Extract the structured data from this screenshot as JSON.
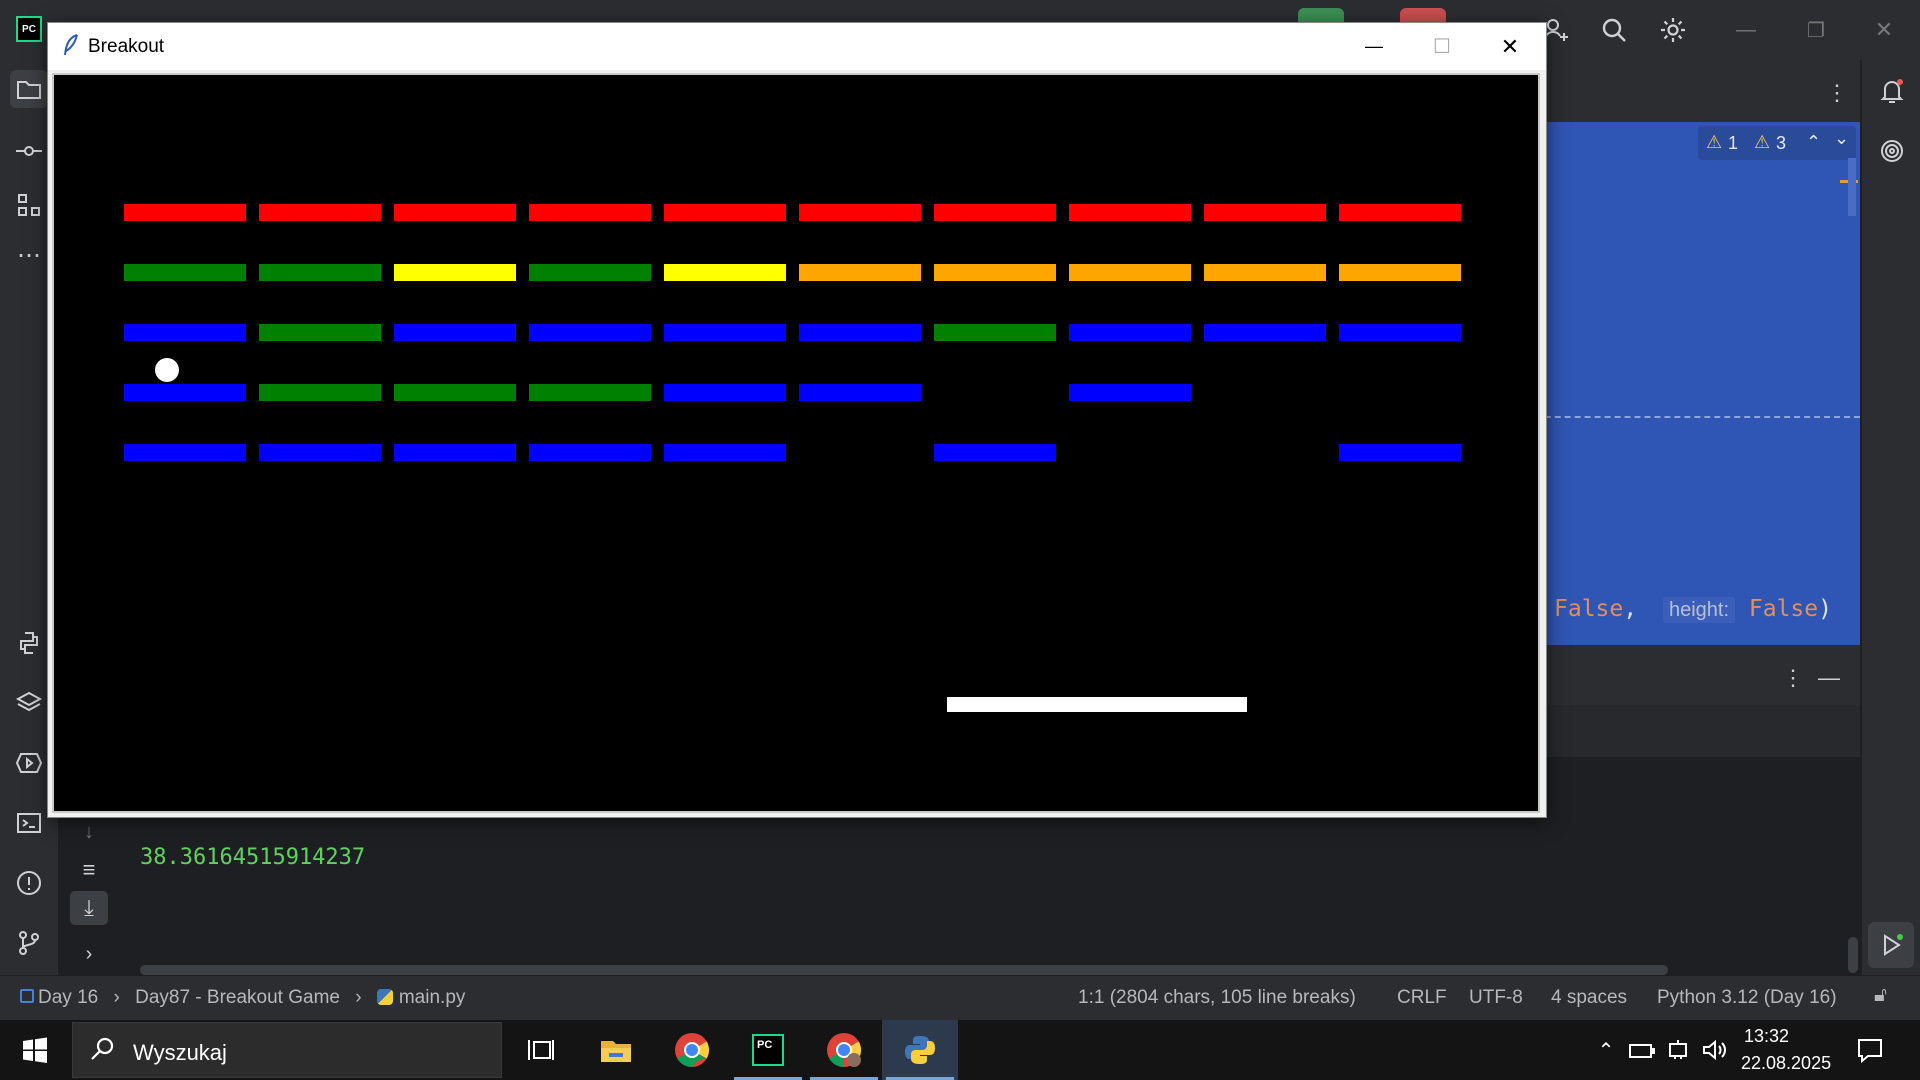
{
  "window": {
    "title": "Breakout",
    "minimize_glyph": "—",
    "maximize_glyph": "☐",
    "close_glyph": "✕"
  },
  "game": {
    "colors": {
      "red": "#ff0000",
      "green": "#008000",
      "yellow": "#ffff00",
      "orange": "#ffa500",
      "blue": "#0000ff",
      "white": "#ffffff",
      "black": "#000000"
    },
    "brick_rows": [
      [
        "red",
        "red",
        "red",
        "red",
        "red",
        "red",
        "red",
        "red",
        "red",
        "red"
      ],
      [
        "green",
        "green",
        "yellow",
        "green",
        "yellow",
        "orange",
        "orange",
        "orange",
        "orange",
        "orange"
      ],
      [
        "blue",
        "green",
        "blue",
        "blue",
        "blue",
        "blue",
        "green",
        "blue",
        "blue",
        "blue"
      ],
      [
        "blue",
        "green",
        "green",
        "green",
        "blue",
        "blue",
        null,
        "blue",
        null,
        null
      ],
      [
        "blue",
        "blue",
        "blue",
        "blue",
        "blue",
        null,
        "blue",
        null,
        null,
        "blue"
      ]
    ]
  },
  "editor": {
    "warnings": {
      "errors": "1",
      "warnings": "3"
    },
    "code_fragment": {
      "value1": "False",
      "comma": ",",
      "hint_label": "height:",
      "value2": "False",
      "paren": ")"
    }
  },
  "console": {
    "output": "38.36164515914237"
  },
  "statusbar": {
    "breadcrumb": [
      "Day 16",
      "Day87 - Breakout Game",
      "main.py"
    ],
    "position": "1:1 (2804 chars, 105 line breaks)",
    "line_ending": "CRLF",
    "encoding": "UTF-8",
    "indent": "4 spaces",
    "interpreter": "Python 3.12 (Day 16)"
  },
  "taskbar": {
    "search_placeholder": "Wyszukaj",
    "time": "13:32",
    "date": "22.08.2025"
  },
  "icons": {
    "accent": "#2f56b4",
    "console_text": "#5fd35f",
    "string_orange": "#e58d5b"
  }
}
